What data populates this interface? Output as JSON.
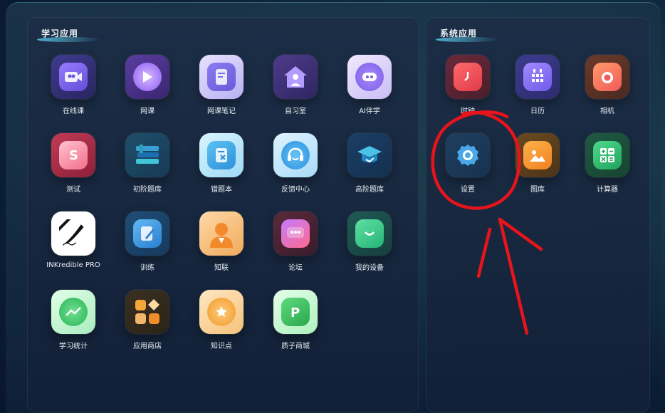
{
  "left_panel": {
    "title": "学习应用",
    "apps": [
      {
        "label": "在线课",
        "icon": "online-class-icon"
      },
      {
        "label": "网课",
        "icon": "play-icon"
      },
      {
        "label": "网课笔记",
        "icon": "notebook-icon"
      },
      {
        "label": "自习室",
        "icon": "study-room-icon"
      },
      {
        "label": "AI伴学",
        "icon": "ai-mascot-icon"
      },
      {
        "label": "测试",
        "icon": "test-icon"
      },
      {
        "label": "初阶题库",
        "icon": "books-icon"
      },
      {
        "label": "错题本",
        "icon": "wrong-notebook-icon"
      },
      {
        "label": "反馈中心",
        "icon": "headset-icon"
      },
      {
        "label": "高阶题库",
        "icon": "graduation-cap-icon"
      },
      {
        "label": "INKredible PRO",
        "icon": "pen-icon"
      },
      {
        "label": "训练",
        "icon": "pencil-book-icon"
      },
      {
        "label": "知联",
        "icon": "person-icon"
      },
      {
        "label": "论坛",
        "icon": "chat-icon"
      },
      {
        "label": "我的设备",
        "icon": "device-icon"
      },
      {
        "label": "学习统计",
        "icon": "stats-icon"
      },
      {
        "label": "应用商店",
        "icon": "app-store-icon"
      },
      {
        "label": "知识点",
        "icon": "star-bulb-icon"
      },
      {
        "label": "质子商城",
        "icon": "p-shop-icon"
      }
    ]
  },
  "right_panel": {
    "title": "系统应用",
    "apps": [
      {
        "label": "时钟",
        "icon": "clock-icon"
      },
      {
        "label": "日历",
        "icon": "calendar-icon"
      },
      {
        "label": "相机",
        "icon": "camera-icon"
      },
      {
        "label": "设置",
        "icon": "gear-icon"
      },
      {
        "label": "图库",
        "icon": "gallery-icon"
      },
      {
        "label": "计算器",
        "icon": "calculator-icon"
      }
    ]
  },
  "colors": {
    "annotation": "#e8141b",
    "background": "#0b1d36"
  }
}
